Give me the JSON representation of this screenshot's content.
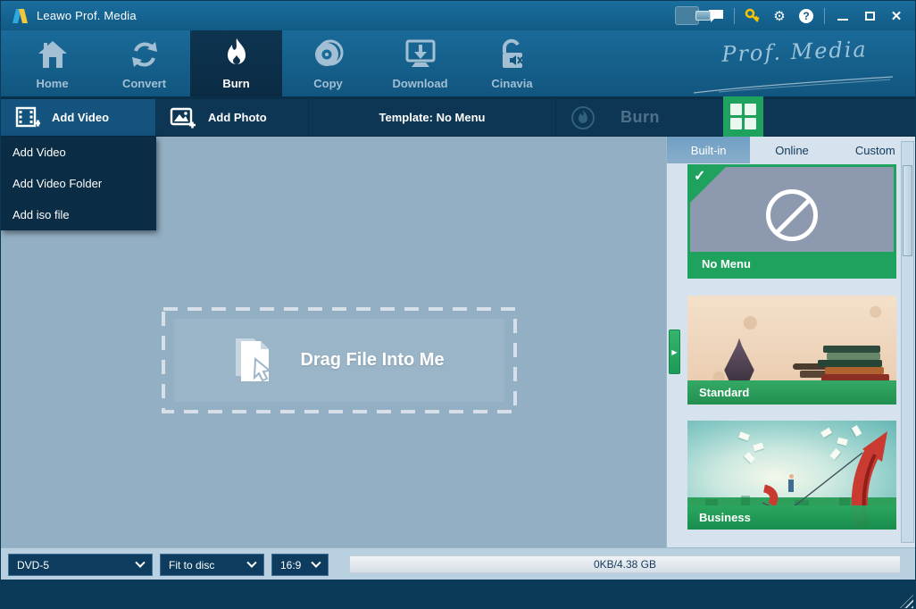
{
  "titlebar": {
    "title": "Leawo Prof. Media"
  },
  "nav": {
    "items": [
      {
        "label": "Home"
      },
      {
        "label": "Convert"
      },
      {
        "label": "Burn",
        "active": true
      },
      {
        "label": "Copy"
      },
      {
        "label": "Download"
      },
      {
        "label": "Cinavia"
      }
    ],
    "brand": "Prof. Media"
  },
  "toolbar": {
    "add_video": "Add Video",
    "add_photo": "Add Photo",
    "template": "Template: No Menu",
    "burn": "Burn"
  },
  "add_video_menu": {
    "items": [
      "Add Video",
      "Add Video Folder",
      "Add iso file"
    ]
  },
  "main": {
    "drop_hint": "Drag File Into Me"
  },
  "template_panel": {
    "tabs": [
      {
        "label": "Built-in",
        "active": true
      },
      {
        "label": "Online",
        "active": false
      },
      {
        "label": "Custom",
        "active": false
      }
    ],
    "templates": [
      {
        "name": "No Menu",
        "selected": true
      },
      {
        "name": "Standard",
        "selected": false
      },
      {
        "name": "Business",
        "selected": false
      }
    ]
  },
  "bottombar": {
    "disc_type": "DVD-5",
    "fit_mode": "Fit to disc",
    "aspect_ratio": "16:9",
    "capacity": "0KB/4.38 GB"
  },
  "icons": {
    "close": "✕",
    "help": "?",
    "gear": "⚙",
    "check": "✓",
    "panel_arrow": "▶"
  },
  "colors": {
    "accent_green": "#1FA25E",
    "titlebar_blue": "#135F8C",
    "toolbar_navy": "#0D3654",
    "main_area": "#93AFC4",
    "panel_bg": "#D6E3EF",
    "select_navy": "#0D3C5F",
    "key_yellow": "#F2C200"
  }
}
